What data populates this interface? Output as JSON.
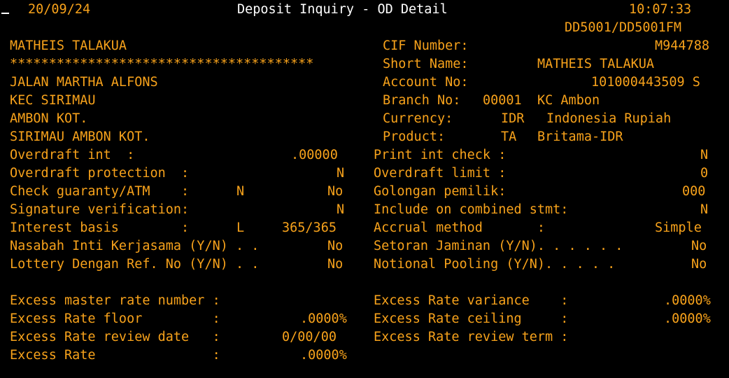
{
  "header": {
    "date": "20/09/24",
    "title": "Deposit Inquiry - OD Detail",
    "time": "10:07:33",
    "program_id": "DD5001/DD5001FM"
  },
  "customer": {
    "name": "MATHEIS TALAKUA",
    "masked_line": "***************************************",
    "address_line1": "JALAN MARTHA ALFONS",
    "address_line2": "KEC SIRIMAU",
    "address_line3": "AMBON KOT.",
    "address_line4": "SIRIMAU AMBON KOT."
  },
  "account": {
    "cif_label": "CIF Number:",
    "cif_value": "M944788",
    "short_name_label": "Short Name:",
    "short_name_value": "MATHEIS TALAKUA",
    "account_no_label": "Account No:",
    "account_no_value": "101000443509 S",
    "branch_label": "Branch No:",
    "branch_code": "00001",
    "branch_name": "KC Ambon",
    "currency_label": "Currency:",
    "currency_code": "IDR",
    "currency_name": "Indonesia Rupiah",
    "product_label": "Product:",
    "product_code": "TA",
    "product_name": "Britama-IDR"
  },
  "left_fields": [
    {
      "label": "Overdraft int  :",
      "code": "",
      "value": ".00000"
    },
    {
      "label": "Overdraft protection  :",
      "code": "",
      "value": "N"
    },
    {
      "label": "Check guaranty/ATM    :",
      "code": "N",
      "value": "No"
    },
    {
      "label": "Signature verification:",
      "code": "",
      "value": "N"
    },
    {
      "label": "Interest basis        :",
      "code": "L",
      "value": "365/365"
    },
    {
      "label": "Nasabah Inti Kerjasama (Y/N) . .",
      "code": "",
      "value": "No"
    },
    {
      "label": "Lottery Dengan Ref. No (Y/N) . .",
      "code": "",
      "value": "No"
    }
  ],
  "right_fields": [
    {
      "label": "Print int check :",
      "value": "N"
    },
    {
      "label": "Overdraft limit :",
      "value": "0"
    },
    {
      "label": "Golongan pemilik:",
      "value": "000"
    },
    {
      "label": "Include on combined stmt:",
      "value": "N"
    },
    {
      "label": "Accrual method       :",
      "value": "Simple"
    },
    {
      "label": "Setoran Jaminan (Y/N). . . . . .",
      "value": "No"
    },
    {
      "label": "Notional Pooling (Y/N). . . . .",
      "value": "No"
    }
  ],
  "excess_left": [
    {
      "label": "Excess master rate number :",
      "value": ""
    },
    {
      "label": "Excess Rate floor         :",
      "value": ".0000%"
    },
    {
      "label": "Excess Rate review date   :",
      "value": "0/00/00"
    },
    {
      "label": "Excess Rate               :",
      "value": ".0000%"
    }
  ],
  "excess_right": [
    {
      "label": "Excess Rate variance    :",
      "value": ".0000%"
    },
    {
      "label": "Excess Rate ceiling     :",
      "value": ".0000%"
    },
    {
      "label": "Excess Rate review term :",
      "value": ""
    }
  ],
  "colors": {
    "background": "#000000",
    "field_text": "#f7a21b",
    "header_text": "#ffffff"
  }
}
